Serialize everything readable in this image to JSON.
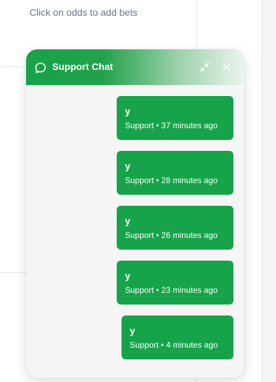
{
  "background": {
    "betslip_empty_text": "Click on odds to add bets"
  },
  "chat": {
    "title": "Support Chat",
    "icon": "chat-bubble-icon",
    "minimize_icon": "minimize-icon",
    "close_icon": "close-icon",
    "accent_color": "#16a34a",
    "messages": [
      {
        "text": "y",
        "sender": "Support",
        "separator": "•",
        "time": "37 minutes ago"
      },
      {
        "text": "y",
        "sender": "Support",
        "separator": "•",
        "time": "28 minutes ago"
      },
      {
        "text": "y",
        "sender": "Support",
        "separator": "•",
        "time": "26 minutes ago"
      },
      {
        "text": "y",
        "sender": "Support",
        "separator": "•",
        "time": "23 minutes ago"
      },
      {
        "text": "y",
        "sender": "Support",
        "separator": "•",
        "time": "4 minutes ago"
      }
    ]
  }
}
